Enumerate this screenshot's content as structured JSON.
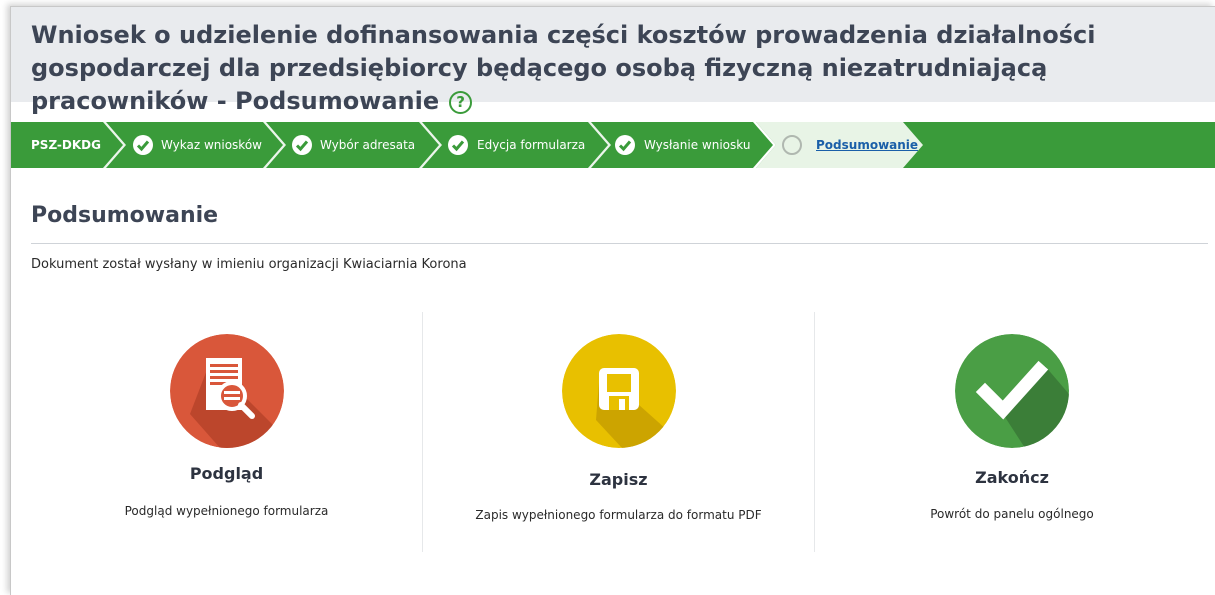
{
  "header": {
    "title": "Wniosek o udzielenie dofinansowania części kosztów prowadzenia działalności gospodarczej dla przedsiębiorcy będącego osobą fizyczną niezatrudniającą pracowników - Podsumowanie",
    "help_icon": "?"
  },
  "steps": {
    "code": "PSZ-DKDG",
    "items": [
      {
        "label": "Wykaz wniosków",
        "state": "done"
      },
      {
        "label": "Wybór adresata",
        "state": "done"
      },
      {
        "label": "Edycja formularza",
        "state": "done"
      },
      {
        "label": "Wysłanie wniosku",
        "state": "done"
      },
      {
        "label": "Podsumowanie",
        "state": "current"
      }
    ]
  },
  "section": {
    "title": "Podsumowanie",
    "info": "Dokument został wysłany w imieniu organizacji Kwiaciarnia Korona"
  },
  "cards": [
    {
      "title": "Podgląd",
      "description": "Podgląd wypełnionego formularza",
      "icon": "document-search-icon",
      "color": "#d9573a"
    },
    {
      "title": "Zapisz",
      "description": "Zapis wypełnionego formularza do formatu PDF",
      "icon": "floppy-disk-icon",
      "color": "#e8c000"
    },
    {
      "title": "Zakończ",
      "description": "Powrót do panelu ogólnego",
      "icon": "checkmark-icon",
      "color": "#4a9e45"
    }
  ],
  "colors": {
    "header_bg": "#e9ebee",
    "steps_bg": "#3a9b3a",
    "title_text": "#3d4555"
  }
}
